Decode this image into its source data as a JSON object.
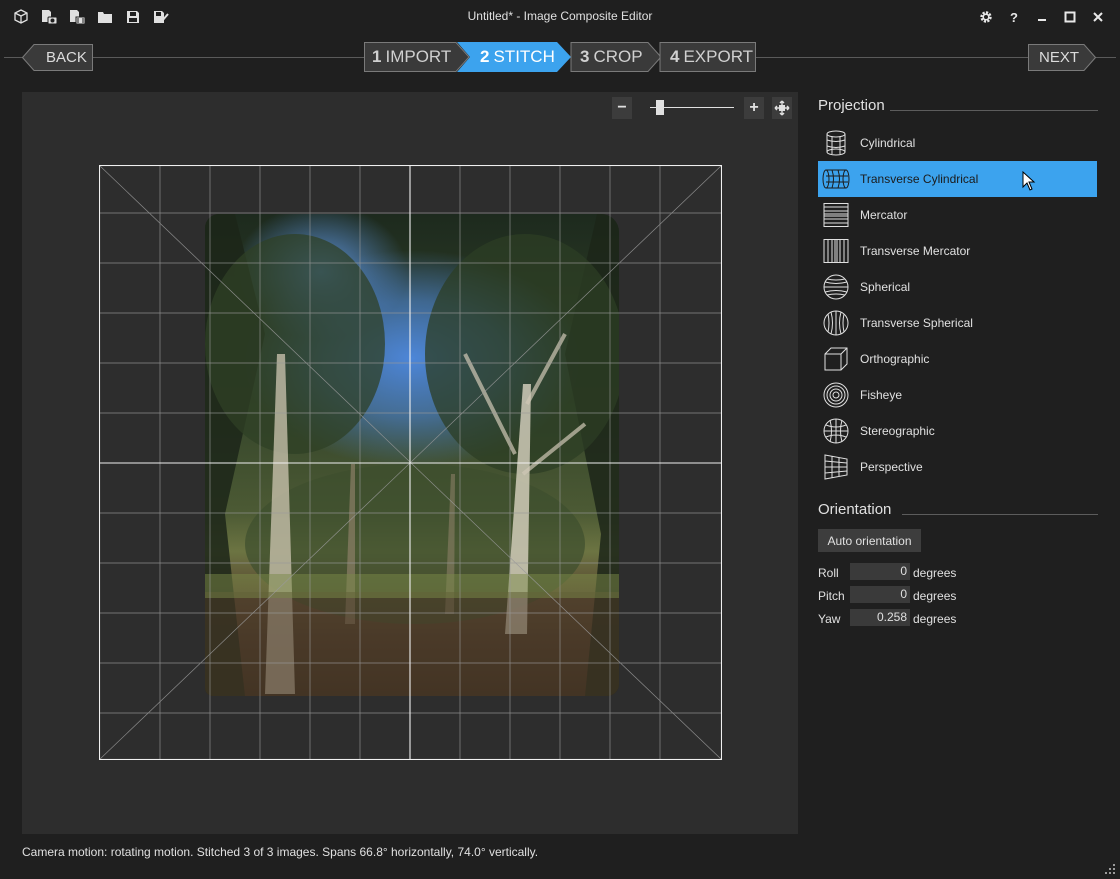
{
  "window": {
    "title": "Untitled* - Image Composite Editor"
  },
  "toolbar": {
    "icons": [
      "new-project-icon",
      "new-panorama-from-images-icon",
      "new-panorama-from-video-icon",
      "open-folder-icon",
      "save-icon",
      "save-as-icon"
    ]
  },
  "window_controls": [
    "settings-icon",
    "help-icon",
    "minimize-icon",
    "maximize-icon",
    "close-icon"
  ],
  "nav": {
    "back_label": "BACK",
    "next_label": "NEXT",
    "steps": [
      {
        "num": "1",
        "label": "IMPORT",
        "active": false
      },
      {
        "num": "2",
        "label": "STITCH",
        "active": true
      },
      {
        "num": "3",
        "label": "CROP",
        "active": false
      },
      {
        "num": "4",
        "label": "EXPORT",
        "active": false
      }
    ]
  },
  "zoom": {
    "minus": "−",
    "plus": "+"
  },
  "projection": {
    "title": "Projection",
    "items": [
      {
        "label": "Cylindrical",
        "icon": "cylindrical-icon",
        "selected": false
      },
      {
        "label": "Transverse Cylindrical",
        "icon": "transverse-cylindrical-icon",
        "selected": true
      },
      {
        "label": "Mercator",
        "icon": "mercator-icon",
        "selected": false
      },
      {
        "label": "Transverse Mercator",
        "icon": "transverse-mercator-icon",
        "selected": false
      },
      {
        "label": "Spherical",
        "icon": "spherical-icon",
        "selected": false
      },
      {
        "label": "Transverse Spherical",
        "icon": "transverse-spherical-icon",
        "selected": false
      },
      {
        "label": "Orthographic",
        "icon": "orthographic-icon",
        "selected": false
      },
      {
        "label": "Fisheye",
        "icon": "fisheye-icon",
        "selected": false
      },
      {
        "label": "Stereographic",
        "icon": "stereographic-icon",
        "selected": false
      },
      {
        "label": "Perspective",
        "icon": "perspective-icon",
        "selected": false
      }
    ]
  },
  "orientation": {
    "title": "Orientation",
    "auto_label": "Auto orientation",
    "roll": {
      "label": "Roll",
      "value": "0",
      "unit": "degrees"
    },
    "pitch": {
      "label": "Pitch",
      "value": "0",
      "unit": "degrees"
    },
    "yaw": {
      "label": "Yaw",
      "value": "0.258",
      "unit": "degrees"
    }
  },
  "status": "Camera motion: rotating motion. Stitched 3 of 3 images. Spans 66.8° horizontally, 74.0° vertically.",
  "colors": {
    "accent": "#3ca3ee",
    "background": "#1f1f1f",
    "canvas": "#2d2d2d"
  }
}
